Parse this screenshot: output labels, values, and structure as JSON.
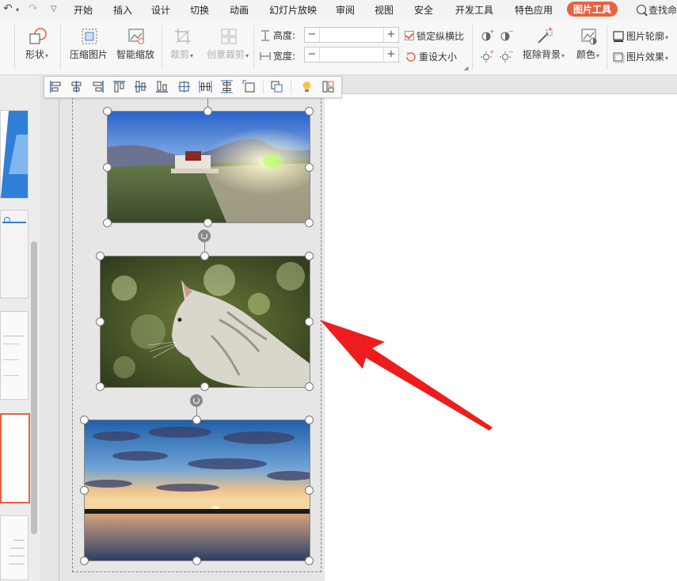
{
  "menubar": {
    "items": [
      "开始",
      "插入",
      "设计",
      "切换",
      "动画",
      "幻灯片放映",
      "审阅",
      "视图",
      "安全",
      "开发工具",
      "特色应用",
      "图片工具"
    ],
    "active": "图片工具",
    "search_label": "查找命"
  },
  "ribbon": {
    "shape_label": "形状",
    "compress_label": "压缩图片",
    "smart_zoom_label": "智能缩放",
    "crop_label": "裁剪",
    "creative_crop_label": "创意裁剪",
    "height_label": "高度:",
    "width_label": "宽度:",
    "height_value": "",
    "width_value": "",
    "lock_ratio_label": "锁定纵横比",
    "lock_ratio_checked": true,
    "reset_size_label": "重设大小",
    "remove_bg_label": "抠除背景",
    "color_label": "颜色",
    "outline_label": "图片轮廓",
    "effect_label": "图片效果"
  },
  "canvas": {
    "pictures": [
      {
        "name": "potala-palace-photo"
      },
      {
        "name": "cat-photo"
      },
      {
        "name": "sunset-lake-photo"
      }
    ]
  },
  "colors": {
    "accent": "#e8623f",
    "arrow": "#ee1c1c"
  }
}
